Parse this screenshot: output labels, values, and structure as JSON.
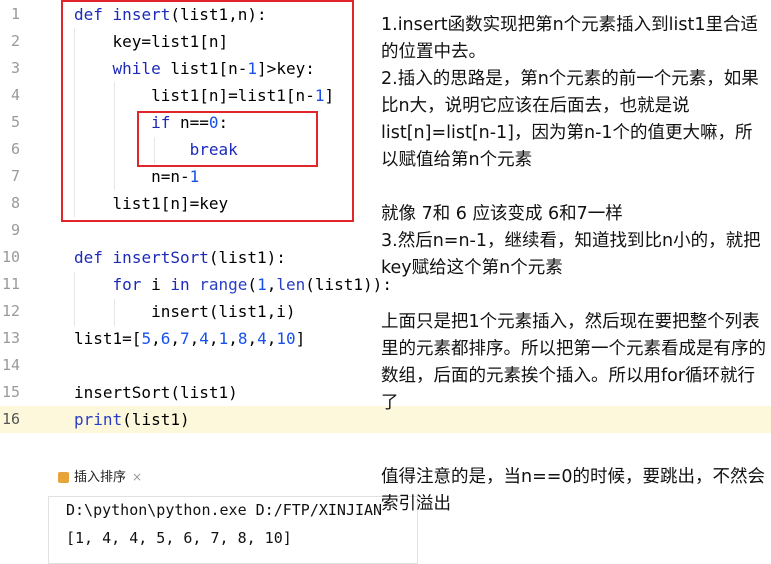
{
  "editor": {
    "lines": [
      {
        "n": "1",
        "tokens": [
          [
            "def",
            "kw"
          ],
          [
            " ",
            ""
          ],
          [
            "insert",
            "fn"
          ],
          [
            "(list1",
            ""
          ],
          [
            ",",
            ""
          ],
          [
            "n",
            ""
          ],
          [
            "):",
            ""
          ]
        ]
      },
      {
        "n": "2",
        "tokens": [
          [
            "    key=list1[n]",
            ""
          ]
        ]
      },
      {
        "n": "3",
        "tokens": [
          [
            "    ",
            ""
          ],
          [
            "while",
            "kw"
          ],
          [
            " list1[n-",
            ""
          ],
          [
            "1",
            "nm"
          ],
          [
            "]>key:",
            ""
          ]
        ]
      },
      {
        "n": "4",
        "tokens": [
          [
            "        list1[n]=list1[n-",
            ""
          ],
          [
            "1",
            "nm"
          ],
          [
            "]",
            ""
          ]
        ]
      },
      {
        "n": "5",
        "tokens": [
          [
            "        ",
            ""
          ],
          [
            "if",
            "kw"
          ],
          [
            " n==",
            ""
          ],
          [
            "0",
            "nm"
          ],
          [
            ":",
            ""
          ]
        ]
      },
      {
        "n": "6",
        "tokens": [
          [
            "            ",
            ""
          ],
          [
            "break",
            "kw"
          ]
        ]
      },
      {
        "n": "7",
        "tokens": [
          [
            "        n=n-",
            ""
          ],
          [
            "1",
            "nm"
          ]
        ]
      },
      {
        "n": "8",
        "tokens": [
          [
            "    list1[n]=key",
            ""
          ]
        ]
      },
      {
        "n": "9",
        "tokens": []
      },
      {
        "n": "10",
        "tokens": [
          [
            "def",
            "kw"
          ],
          [
            " ",
            ""
          ],
          [
            "insertSort",
            "fn"
          ],
          [
            "(list1):",
            ""
          ]
        ]
      },
      {
        "n": "11",
        "tokens": [
          [
            "    ",
            ""
          ],
          [
            "for",
            "kw"
          ],
          [
            " i ",
            ""
          ],
          [
            "in",
            "kw"
          ],
          [
            " ",
            ""
          ],
          [
            "range",
            "pl"
          ],
          [
            "(",
            ""
          ],
          [
            "1",
            "nm"
          ],
          [
            ",",
            ""
          ],
          [
            "len",
            "pl"
          ],
          [
            "(list1)):",
            ""
          ]
        ]
      },
      {
        "n": "12",
        "tokens": [
          [
            "        insert(list1",
            ""
          ],
          [
            ",",
            ""
          ],
          [
            "i)",
            ""
          ]
        ]
      },
      {
        "n": "13",
        "tokens": [
          [
            "list1=[",
            ""
          ],
          [
            "5",
            "nm"
          ],
          [
            ",",
            ""
          ],
          [
            "6",
            "nm"
          ],
          [
            ",",
            ""
          ],
          [
            "7",
            "nm"
          ],
          [
            ",",
            ""
          ],
          [
            "4",
            "nm"
          ],
          [
            ",",
            ""
          ],
          [
            "1",
            "nm"
          ],
          [
            ",",
            ""
          ],
          [
            "8",
            "nm"
          ],
          [
            ",",
            ""
          ],
          [
            "4",
            "nm"
          ],
          [
            ",",
            ""
          ],
          [
            "10",
            "nm"
          ],
          [
            "]",
            ""
          ]
        ]
      },
      {
        "n": "14",
        "tokens": []
      },
      {
        "n": "15",
        "tokens": [
          [
            "insertSort(list1)",
            ""
          ]
        ]
      },
      {
        "n": "16",
        "tokens": [
          [
            "print",
            "pl"
          ],
          [
            "(list1)",
            ""
          ]
        ]
      }
    ],
    "current_line": "16"
  },
  "explanation": {
    "p1": "1.insert函数实现把第n个元素插入到list1里合适的位置中去。",
    "p2": "2.插入的思路是，第n个元素的前一个元素，如果比n大，说明它应该在后面去，也就是说list[n]=list[n-1]，因为第n-1个的值更大嘛，所以赋值给第n个元素",
    "p3": "就像 7和 6 应该变成 6和7一样",
    "p4": "3.然后n=n-1，继续看，知道找到比n小的，就把key赋给这个第n个元素",
    "p5": "上面只是把1个元素插入，然后现在要把整个列表里的元素都排序。所以把第一个元素看成是有序的数组，后面的元素挨个插入。所以用for循环就行了",
    "p6": "值得注意的是，当n==0的时候，要跳出，不然会索引溢出"
  },
  "run": {
    "tab_label": "插入排序",
    "close_glyph": "×",
    "command": "D:\\python\\python.exe D:/FTP/XINJIAN",
    "output": "[1, 4, 4, 5, 6, 7, 8, 10]"
  },
  "colors": {
    "keyword": "#1c2ab8",
    "number": "#1750eb",
    "highlight_box": "#e0262b",
    "current_line_bg": "#fdf7dc"
  }
}
